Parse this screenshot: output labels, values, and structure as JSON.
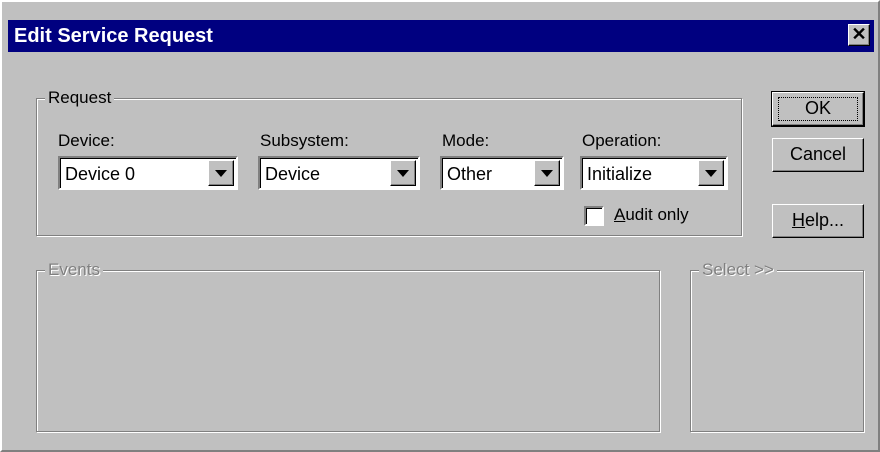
{
  "window": {
    "title": "Edit Service Request",
    "close_glyph": "✕"
  },
  "request_group": {
    "label": "Request",
    "device": {
      "label": "Device:",
      "value": "Device 0"
    },
    "subsystem": {
      "label": "Subsystem:",
      "value": "Device"
    },
    "mode": {
      "label": "Mode:",
      "value": "Other"
    },
    "operation": {
      "label": "Operation:",
      "value": "Initialize"
    },
    "audit_only": {
      "mnemonic": "A",
      "rest": "udit only",
      "checked": false
    }
  },
  "buttons": {
    "ok": "OK",
    "cancel": "Cancel",
    "help_mnemonic": "H",
    "help_rest": "elp..."
  },
  "events_group": {
    "label": "Events"
  },
  "select_group": {
    "label": "Select >>"
  },
  "colors": {
    "titlebar": "#000080",
    "face": "#c0c0c0",
    "disabled_text": "#808080"
  },
  "icons": {
    "close": "close-icon",
    "dropdown": "dropdown-arrow-icon"
  }
}
